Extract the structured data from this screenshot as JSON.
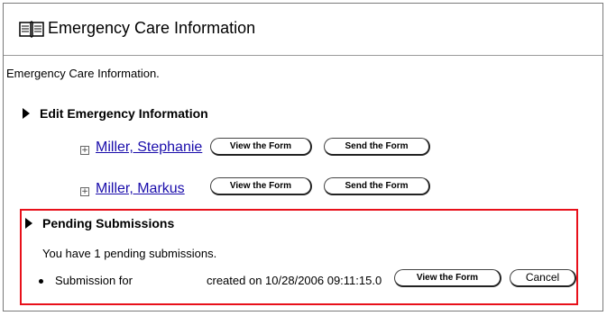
{
  "header": {
    "title": "Emergency Care Information",
    "icon": "book-icon"
  },
  "intro_text": "Emergency Care Information.",
  "edit_section": {
    "heading": "Edit Emergency Information",
    "people": [
      {
        "name": "Miller, Stephanie",
        "view_label": "View the Form",
        "send_label": "Send the Form"
      },
      {
        "name": "Miller, Markus",
        "view_label": "View the Form",
        "send_label": "Send the Form"
      }
    ]
  },
  "pending_section": {
    "heading": "Pending Submissions",
    "summary": "You have 1 pending submissions.",
    "item": {
      "label": "Submission for",
      "created": "created on 10/28/2006 09:11:15.0",
      "view_label": "View the Form",
      "cancel_label": "Cancel"
    },
    "highlight_color": "#e8101a"
  }
}
